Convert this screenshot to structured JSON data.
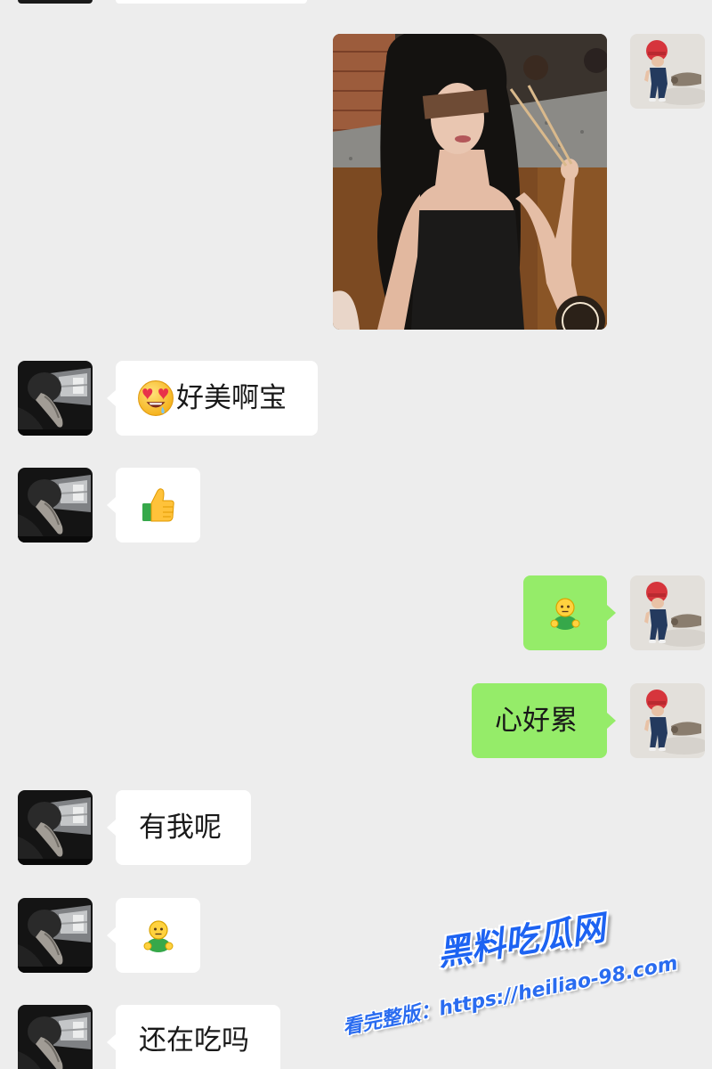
{
  "avatars": {
    "contact": "contact-avatar-icon",
    "self": "self-avatar-icon"
  },
  "chat": {
    "messages": [
      {
        "image_icon": "photo-icon"
      },
      {
        "emoji_icon": "heart-eyes-emoji-icon",
        "text": "好美啊宝"
      },
      {
        "emoji_icon": "thumbs-up-emoji-icon"
      },
      {
        "emoji_icon": "smiling-figure-emoji-icon"
      },
      {
        "text": "心好累"
      },
      {
        "text": "有我呢"
      },
      {
        "emoji_icon": "smiling-figure-emoji-icon"
      },
      {
        "text": "还在吃吗"
      }
    ]
  },
  "watermark": {
    "brand": "黑料吃瓜网",
    "url_text": "看完整版：https://heiliao-98.com"
  },
  "colors": {
    "background": "#ededed",
    "incoming_bubble": "#ffffff",
    "outgoing_bubble": "#95ec69",
    "message_text": "#191919",
    "watermark": "#1d63f2"
  }
}
